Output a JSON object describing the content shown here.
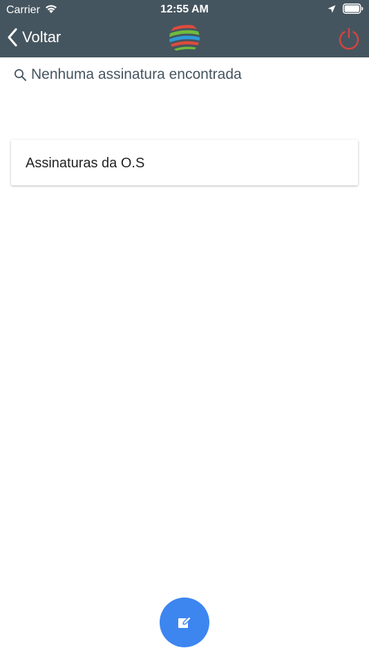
{
  "status_bar": {
    "carrier": "Carrier",
    "time": "12:55 AM"
  },
  "nav": {
    "back_label": "Voltar"
  },
  "search": {
    "text": "Nenhuma assinatura encontrada"
  },
  "card": {
    "title": "Assinaturas da O.S"
  },
  "colors": {
    "header_bg": "#45555f",
    "power_icon": "#d9433f",
    "fab_bg": "#3d86f0"
  },
  "icons": {
    "back": "chevron-left-icon",
    "power": "power-icon",
    "search": "search-icon",
    "fab": "edit-icon"
  }
}
